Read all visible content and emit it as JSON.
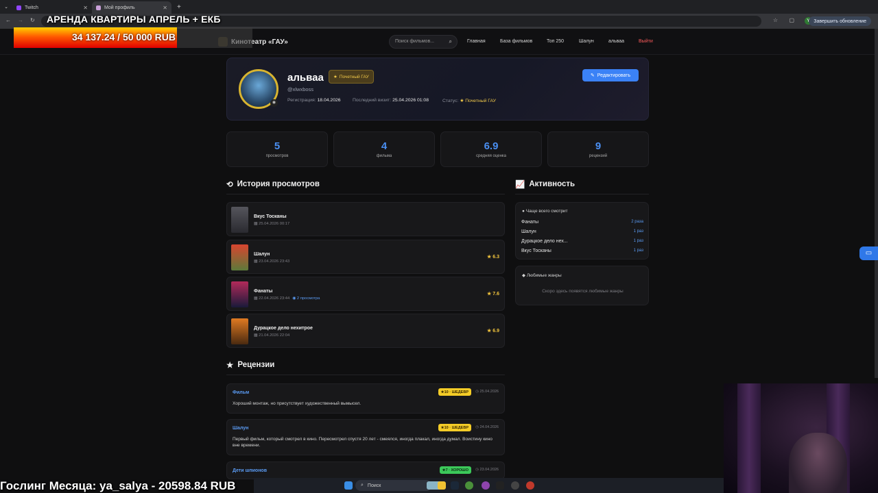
{
  "browser": {
    "tabs": [
      {
        "label": "Twitch",
        "favicon_color": "#9146ff"
      },
      {
        "label": "Мой профиль",
        "favicon_color": "#c9a0d8"
      }
    ],
    "update_button": "Завершить обновление",
    "account_initial": "Y"
  },
  "overlay": {
    "title": "АРЕНДА КВАРТИРЫ АПРЕЛЬ + ЕКБ",
    "progress_text": "34 137.24 / 50 000 RUB",
    "progress_fraction": 0.683,
    "bottom_text": "Гослинг Месяца: ya_salya - 20598.84 RUB"
  },
  "taskbar": {
    "search_label": "Поиск"
  },
  "header": {
    "logo_text": "Кинотеатр «ГАУ»",
    "search_placeholder": "Поиск фильмов...",
    "nav": [
      "Главная",
      "База фильмов",
      "Топ 250",
      "Шалун",
      "альваа"
    ],
    "logout": "Выйти"
  },
  "profile": {
    "name": "альваа",
    "badge": "Почетный ГАУ",
    "handle": "@xlwxboss",
    "reg_label": "Регистрация:",
    "reg_date": "18.04.2026",
    "last_label": "Последний визит:",
    "last_visit": "25.04.2026 01:08",
    "status_label": "Статус:",
    "status": "Почетный ГАУ",
    "edit_button": "Редактировать"
  },
  "stats": [
    {
      "value": "5",
      "label": "просмотров"
    },
    {
      "value": "4",
      "label": "фильма"
    },
    {
      "value": "6.9",
      "label": "средняя оценка"
    },
    {
      "value": "9",
      "label": "рецензий"
    }
  ],
  "history": {
    "title": "История просмотров",
    "items": [
      {
        "title": "Вкус Тосканы",
        "date": "25.04.2026 00:17",
        "views": "",
        "rating": "",
        "poster_color": "#3a3a40"
      },
      {
        "title": "Шалун",
        "date": "23.04.2026 23:43",
        "views": "",
        "rating": "6.3",
        "poster_color": "#b03a2e"
      },
      {
        "title": "Фанаты",
        "date": "22.04.2026 23:44",
        "views": "2 просмотра",
        "rating": "7.6",
        "poster_color": "#7a2250"
      },
      {
        "title": "Дурацкое дело нехитрое",
        "date": "21.04.2026 22:04",
        "views": "",
        "rating": "6.9",
        "poster_color": "#c96a1c"
      }
    ]
  },
  "activity": {
    "title": "Активность",
    "most_watched_header": "Чаще всего смотрит",
    "most_watched": [
      {
        "title": "Фанаты",
        "count": "2 раза"
      },
      {
        "title": "Шалун",
        "count": "1 раз"
      },
      {
        "title": "Дурацкое дело нех...",
        "count": "1 раз"
      },
      {
        "title": "Вкус Тосканы",
        "count": "1 раз"
      }
    ],
    "genres_header": "Любимые жанры",
    "genres_empty": "Скоро здесь появятся любимые жанры"
  },
  "reviews": {
    "title": "Рецензии",
    "items": [
      {
        "film": "Фильм",
        "tag": "10 · ШЕДЕВР",
        "date": "25.04.2026",
        "text": "Хороший монтаж, но присутствует художественный вымысел."
      },
      {
        "film": "Шалун",
        "tag": "10 · ШЕДЕВР",
        "date": "24.04.2026",
        "text": "Первый фильм, который смотрел в кино. Пересмотрел спустя 20 лет - смеялся, иногда плакал, иногда думал. Воистину кино вне времени."
      },
      {
        "film": "Дети шпионов",
        "tag": "7 · ХОРОШО",
        "date": "23.04.2026",
        "text": ""
      }
    ]
  }
}
